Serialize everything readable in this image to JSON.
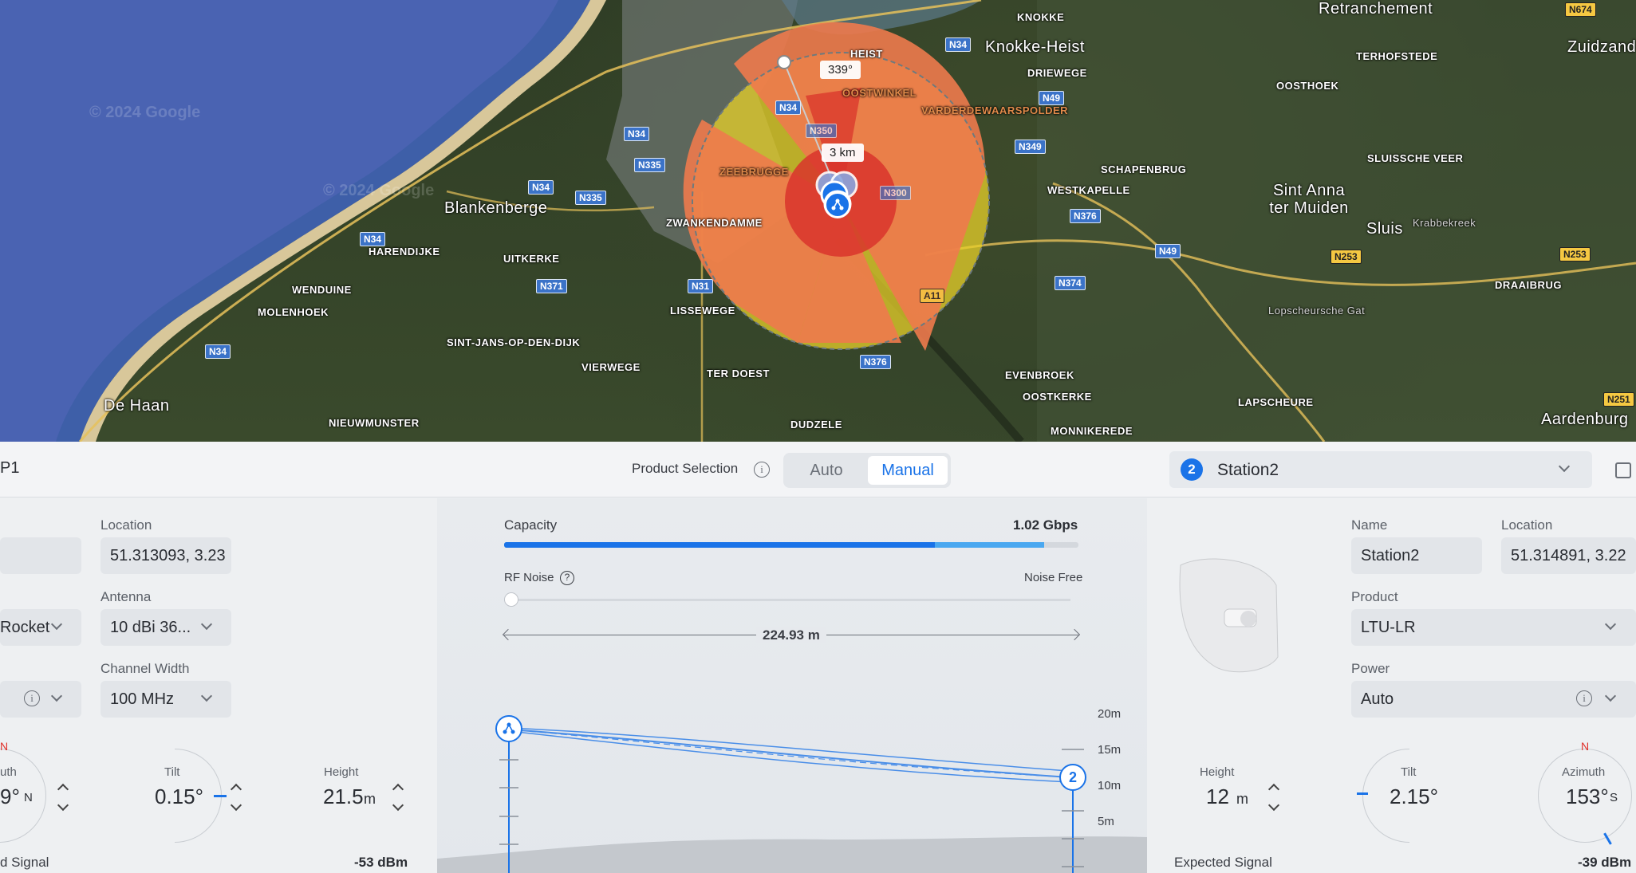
{
  "map": {
    "watermark": "© 2024 Google",
    "bearing_label": "339°",
    "range_label": "3 km",
    "places": [
      {
        "name": "KNOKKE",
        "cls": "sm"
      },
      {
        "name": "Knokke-Heist",
        "cls": "lg"
      },
      {
        "name": "Retranchement",
        "cls": "lg"
      },
      {
        "name": "Zuidzand",
        "cls": "lg"
      },
      {
        "name": "TERHOFSTEDE",
        "cls": "sm"
      },
      {
        "name": "HEIST",
        "cls": "sm"
      },
      {
        "name": "DRIEWEGE",
        "cls": "sm"
      },
      {
        "name": "OOSTHOEK",
        "cls": "sm"
      },
      {
        "name": "OOSTWINKEL",
        "cls": "sm"
      },
      {
        "name": "VARDERDEWAARSPOLDER",
        "cls": "sm"
      },
      {
        "name": "SLUISSCHE VEER",
        "cls": "sm"
      },
      {
        "name": "SCHAPENBRUG",
        "cls": "sm"
      },
      {
        "name": "ZEEBRUGGE",
        "cls": "sm"
      },
      {
        "name": "WESTKAPELLE",
        "cls": "sm"
      },
      {
        "name": "Sint Anna ter Muiden",
        "cls": "lg"
      },
      {
        "name": "Blankenberge",
        "cls": "lg"
      },
      {
        "name": "ZWANKENDAMME",
        "cls": "sm"
      },
      {
        "name": "Sluis",
        "cls": "lg"
      },
      {
        "name": "Krabbekreek",
        "cls": "gray"
      },
      {
        "name": "HARENDIJKE",
        "cls": "sm"
      },
      {
        "name": "UITKERKE",
        "cls": "sm"
      },
      {
        "name": "DRAAIBRUG",
        "cls": "sm"
      },
      {
        "name": "WENDUINE",
        "cls": "sm"
      },
      {
        "name": "MOLENHOEK",
        "cls": "sm"
      },
      {
        "name": "LISSEWEGE",
        "cls": "sm"
      },
      {
        "name": "Lopscheursche Gat",
        "cls": "gray"
      },
      {
        "name": "SINT-JANS-OP-DEN-DIJK",
        "cls": "sm"
      },
      {
        "name": "VIERWEGE",
        "cls": "sm"
      },
      {
        "name": "TER DOEST",
        "cls": "sm"
      },
      {
        "name": "EVENBROEK",
        "cls": "sm"
      },
      {
        "name": "OOSTKERKE",
        "cls": "sm"
      },
      {
        "name": "De Haan",
        "cls": "lg"
      },
      {
        "name": "LAPSCHEURE",
        "cls": "sm"
      },
      {
        "name": "NIEUWMUNSTER",
        "cls": "sm"
      },
      {
        "name": "DUDZELE",
        "cls": "sm"
      },
      {
        "name": "MONNIKEREDE",
        "cls": "sm"
      },
      {
        "name": "Aardenburg",
        "cls": "lg"
      }
    ],
    "shields": [
      {
        "text": "N674",
        "yellow": true
      },
      {
        "text": "N34",
        "yellow": false
      },
      {
        "text": "N49",
        "yellow": false
      },
      {
        "text": "N34",
        "yellow": false
      },
      {
        "text": "N349",
        "yellow": false
      },
      {
        "text": "N34",
        "yellow": false
      },
      {
        "text": "N335",
        "yellow": false
      },
      {
        "text": "N335",
        "yellow": false
      },
      {
        "text": "N34",
        "yellow": false
      },
      {
        "text": "N376",
        "yellow": false
      },
      {
        "text": "N49",
        "yellow": false
      },
      {
        "text": "N253",
        "yellow": true
      },
      {
        "text": "N253",
        "yellow": true
      },
      {
        "text": "N34",
        "yellow": false
      },
      {
        "text": "N371",
        "yellow": false
      },
      {
        "text": "N31",
        "yellow": false
      },
      {
        "text": "N374",
        "yellow": false
      },
      {
        "text": "N34",
        "yellow": false
      },
      {
        "text": "N376",
        "yellow": false
      },
      {
        "text": "N251",
        "yellow": true
      },
      {
        "text": "N350",
        "yellow": false
      },
      {
        "text": "N300",
        "yellow": false
      },
      {
        "text": "A11",
        "yellow": false
      }
    ]
  },
  "topbar": {
    "left_title": "P1",
    "product_selection_label": "Product Selection",
    "mode_auto": "Auto",
    "mode_manual": "Manual",
    "station_badge": "2",
    "station_name": "Station2"
  },
  "left": {
    "location_label": "Location",
    "location_value": "51.313093, 3.23",
    "antenna_label": "Antenna",
    "antenna_value": "10 dBi 36...",
    "product_value": "Rocket",
    "channel_width_label": "Channel Width",
    "channel_width_value": "100 MHz",
    "azimuth_label": "uth",
    "azimuth_value": "9°",
    "azimuth_dir": "N",
    "north_mark": "N",
    "tilt_label": "Tilt",
    "tilt_value": "0.15°",
    "height_label": "Height",
    "height_value": "21.5",
    "height_unit": "m",
    "signal_label": "d Signal",
    "signal_value": "-53 dBm"
  },
  "center": {
    "capacity_label": "Capacity",
    "capacity_value": "1.02 Gbps",
    "capacity_fill": 0.94,
    "capacity_dark_fill": 0.75,
    "rf_noise_label": "RF Noise",
    "rf_noise_value": "Noise Free",
    "distance_value": "224.93 m",
    "scale_ticks": [
      "20m",
      "15m",
      "10m",
      "5m"
    ],
    "station_marker": "2"
  },
  "right": {
    "name_label": "Name",
    "name_value": "Station2",
    "location_label": "Location",
    "location_value": "51.314891, 3.22",
    "product_label": "Product",
    "product_value": "LTU-LR",
    "power_label": "Power",
    "power_value": "Auto",
    "height_label": "Height",
    "height_value": "12",
    "height_unit": "m",
    "tilt_label": "Tilt",
    "tilt_value": "2.15°",
    "azimuth_label": "Azimuth",
    "azimuth_value": "153°",
    "azimuth_dir": "S",
    "north_mark": "N",
    "signal_label": "Expected Signal",
    "signal_value": "-39 dBm"
  },
  "colors": {
    "accent": "#1a73e8",
    "bar_light": "#4aa8f0",
    "coverage_red": "#d9342b",
    "coverage_orange": "#ee7a4c",
    "coverage_yellow": "#e8d02a",
    "north_red": "#e0302a"
  }
}
